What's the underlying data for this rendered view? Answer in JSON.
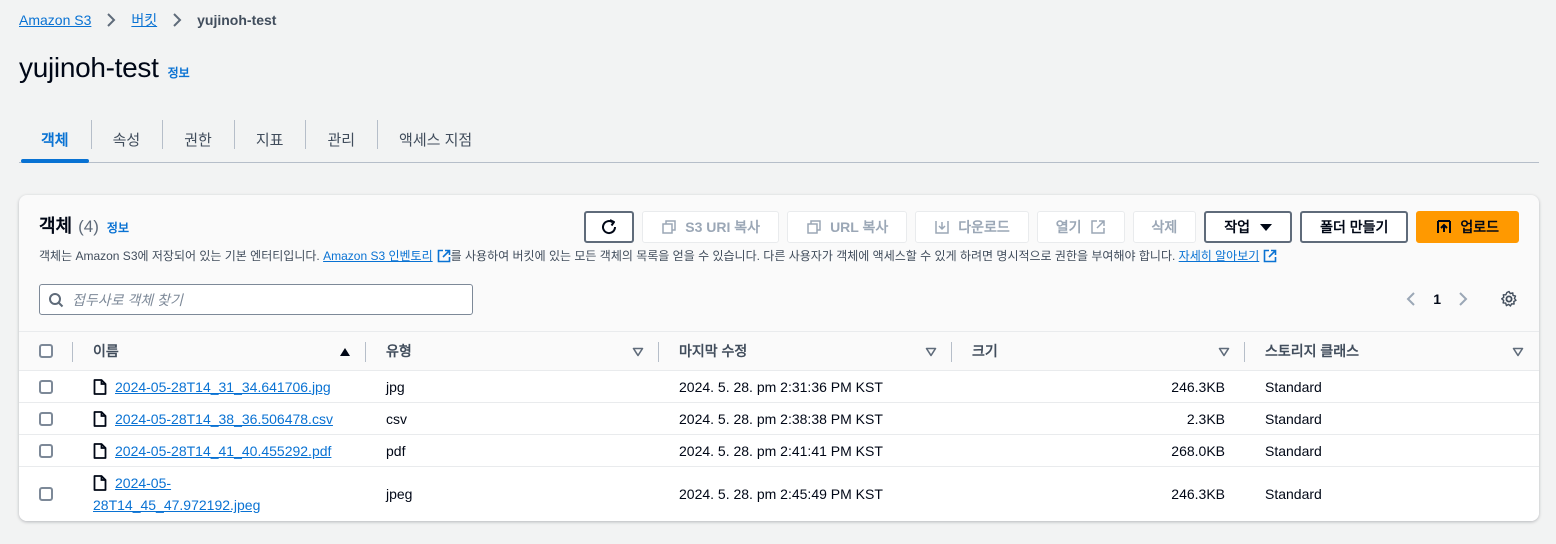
{
  "breadcrumb": {
    "root": "Amazon S3",
    "buckets": "버킷",
    "current": "yujinoh-test"
  },
  "page": {
    "title": "yujinoh-test",
    "info": "정보"
  },
  "tabs": [
    {
      "label": "객체",
      "active": true
    },
    {
      "label": "속성"
    },
    {
      "label": "권한"
    },
    {
      "label": "지표"
    },
    {
      "label": "관리"
    },
    {
      "label": "액세스 지점"
    }
  ],
  "objects_panel": {
    "title": "객체",
    "count": "(4)",
    "info": "정보",
    "desc_part1": "객체는 Amazon S3에 저장되어 있는 기본 엔터티입니다. ",
    "desc_link1": "Amazon S3 인벤토리",
    "desc_part2": "를 사용하여 버킷에 있는 모든 객체의 목록을 얻을 수 있습니다. 다른 사용자가 객체에 액세스할 수 있게 하려면 명시적으로 권한을 부여해야 합니다. ",
    "desc_link2": "자세히 알아보기",
    "search_placeholder": "접두사로 객체 찾기",
    "page_number": "1"
  },
  "toolbar": {
    "refresh_icon": "refresh-icon",
    "copy_s3_uri": "S3 URI 복사",
    "copy_url": "URL 복사",
    "download": "다운로드",
    "open": "열기",
    "delete": "삭제",
    "actions": "작업",
    "create_folder": "폴더 만들기",
    "upload": "업로드",
    "upload_color": "#ff9900"
  },
  "table": {
    "columns": {
      "name": "이름",
      "type": "유형",
      "modified": "마지막 수정",
      "size": "크기",
      "storage_class": "스토리지 클래스"
    },
    "rows": [
      {
        "name": "2024-05-28T14_31_34.641706.jpg",
        "type": "jpg",
        "modified": "2024. 5. 28. pm 2:31:36 PM KST",
        "size": "246.3KB",
        "storage_class": "Standard"
      },
      {
        "name": "2024-05-28T14_38_36.506478.csv",
        "type": "csv",
        "modified": "2024. 5. 28. pm 2:38:38 PM KST",
        "size": "2.3KB",
        "storage_class": "Standard"
      },
      {
        "name": "2024-05-28T14_41_40.455292.pdf",
        "type": "pdf",
        "modified": "2024. 5. 28. pm 2:41:41 PM KST",
        "size": "268.0KB",
        "storage_class": "Standard"
      },
      {
        "name_line1": "2024-05-",
        "name_line2": "28T14_45_47.972192.jpeg",
        "type": "jpeg",
        "modified": "2024. 5. 28. pm 2:45:49 PM KST",
        "size": "246.3KB",
        "storage_class": "Standard"
      }
    ]
  }
}
